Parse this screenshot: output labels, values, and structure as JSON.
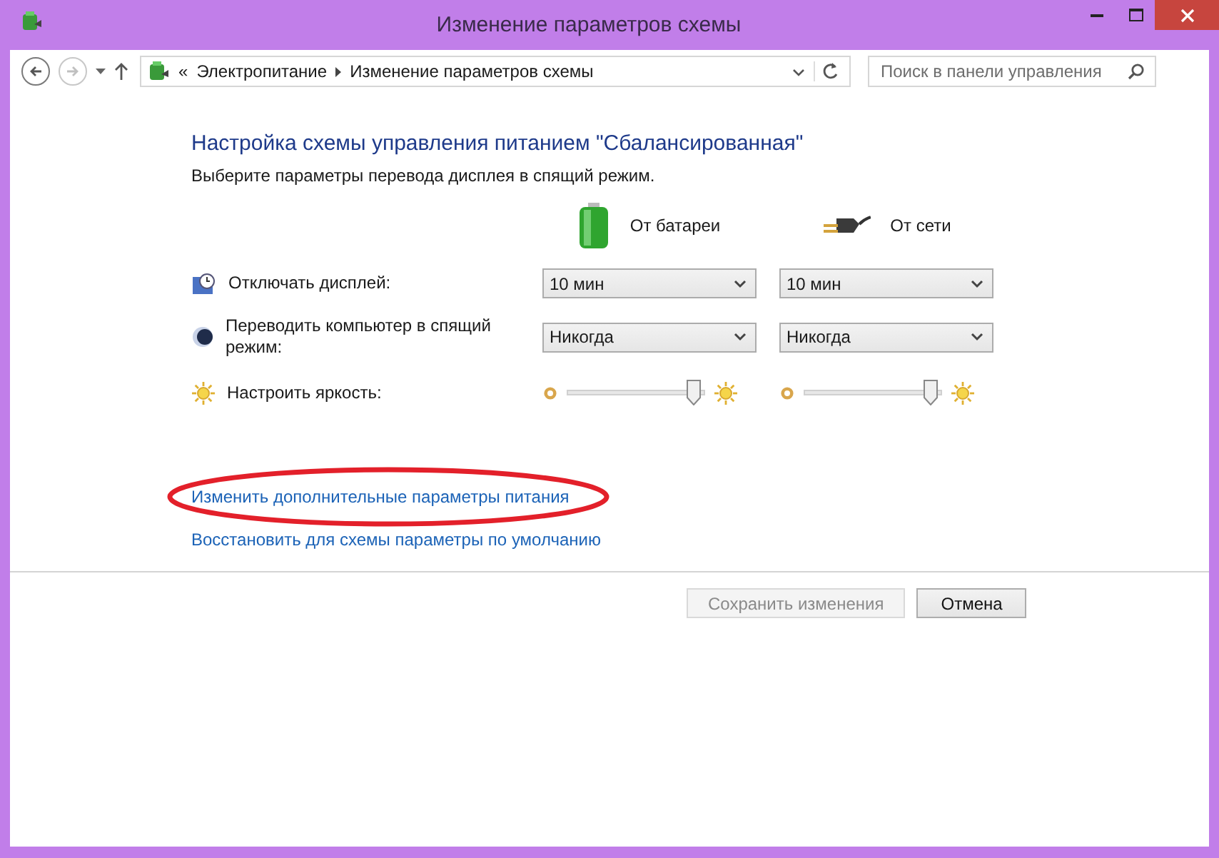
{
  "window": {
    "title": "Изменение параметров схемы"
  },
  "nav": {
    "back": {
      "disabled": false
    },
    "forward": {
      "disabled": true
    },
    "overflow": "«",
    "breadcrumb": [
      "Электропитание",
      "Изменение параметров схемы"
    ],
    "search": {
      "placeholder": "Поиск в панели управления"
    }
  },
  "heading": "Настройка схемы управления питанием \"Сбалансированная\"",
  "subtitle": "Выберите параметры перевода дисплея в спящий режим.",
  "columns": [
    {
      "label": "От батареи",
      "kind": "battery"
    },
    {
      "label": "От сети",
      "kind": "plug"
    }
  ],
  "settings": [
    {
      "label": "Отключать дисплей:",
      "kind": "select",
      "values": [
        "10 мин",
        "10 мин"
      ]
    },
    {
      "label": "Переводить компьютер в спящий режим:",
      "kind": "select",
      "values": [
        "Никогда",
        "Никогда"
      ]
    },
    {
      "label": "Настроить яркость:",
      "kind": "slider",
      "levels": [
        {
          "level": 0.97
        },
        {
          "level": 0.97
        }
      ]
    }
  ],
  "links": [
    {
      "label": "Изменить дополнительные параметры питания",
      "circled": true
    },
    {
      "label": "Восстановить для схемы параметры по умолчанию",
      "circled": false
    }
  ],
  "buttons": [
    {
      "label": "Сохранить изменения",
      "disabled": true
    },
    {
      "label": "Отмена",
      "disabled": false
    }
  ]
}
